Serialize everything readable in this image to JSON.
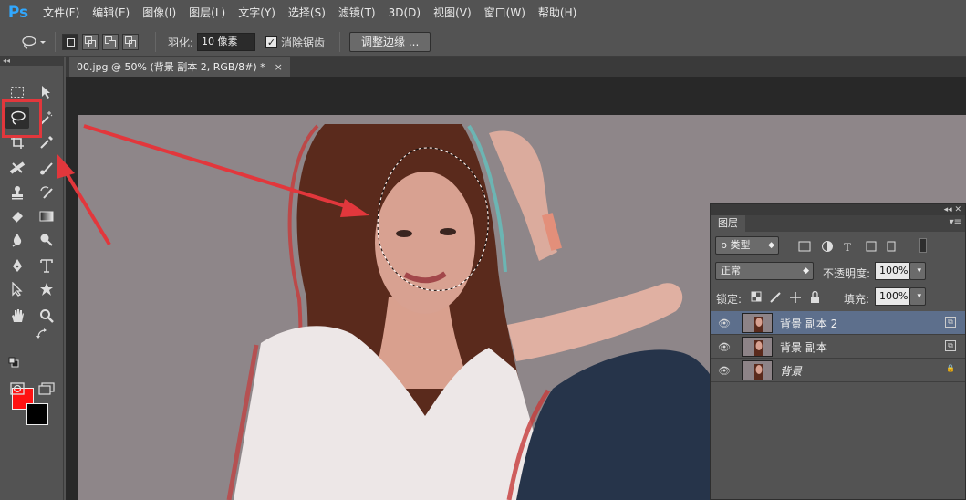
{
  "app": {
    "logo": "Ps"
  },
  "menu": [
    "文件(F)",
    "编辑(E)",
    "图像(I)",
    "图层(L)",
    "文字(Y)",
    "选择(S)",
    "滤镜(T)",
    "3D(D)",
    "视图(V)",
    "窗口(W)",
    "帮助(H)"
  ],
  "options": {
    "feather_label": "羽化:",
    "feather_value": "10 像素",
    "antialias_label": "消除锯齿",
    "antialias_checked": true,
    "refine_edge": "调整边缘 ..."
  },
  "toolbox": {
    "collapse": "◂◂",
    "foreground_color": "#ff1111",
    "background_color": "#000000",
    "selected_tool": "lasso-tool"
  },
  "document": {
    "tab_title": "00.jpg @ 50% (背景 副本 2, RGB/8#) *",
    "close": "×"
  },
  "layers_panel": {
    "tab": "图层",
    "filter_type": "ρ 类型",
    "blend_mode": "正常",
    "opacity_label": "不透明度:",
    "opacity_value": "100%",
    "lock_label": "锁定:",
    "fill_label": "填充:",
    "fill_value": "100%",
    "layers": [
      {
        "name": "背景 副本 2",
        "selected": true,
        "locked": false
      },
      {
        "name": "背景 副本",
        "selected": false,
        "locked": false
      },
      {
        "name": "背景",
        "selected": false,
        "locked": true
      }
    ]
  },
  "accent_colors": {
    "annotation_red": "#e2373c",
    "selection_blue": "#5d6f8c"
  }
}
